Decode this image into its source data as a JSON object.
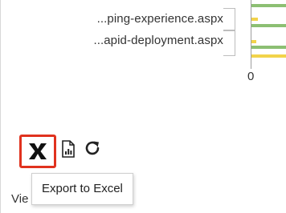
{
  "chart": {
    "row_labels": [
      "...ping-experience.aspx",
      "...apid-deployment.aspx"
    ],
    "x_axis_tick_zero": "0",
    "colors": {
      "series_green": "#8cbf73",
      "series_yellow": "#f2d34b",
      "axis": "#9e9e9e"
    }
  },
  "toolbar": {
    "buttons": [
      {
        "name": "export-to-excel",
        "icon": "excel-x-icon",
        "highlighted": true,
        "highlight_color": "#e0321e"
      },
      {
        "name": "report",
        "icon": "report-document-icon"
      },
      {
        "name": "refresh",
        "icon": "refresh-icon"
      }
    ]
  },
  "tooltip": {
    "text": "Export to Excel"
  },
  "footer": {
    "partial_text": "Vie"
  }
}
